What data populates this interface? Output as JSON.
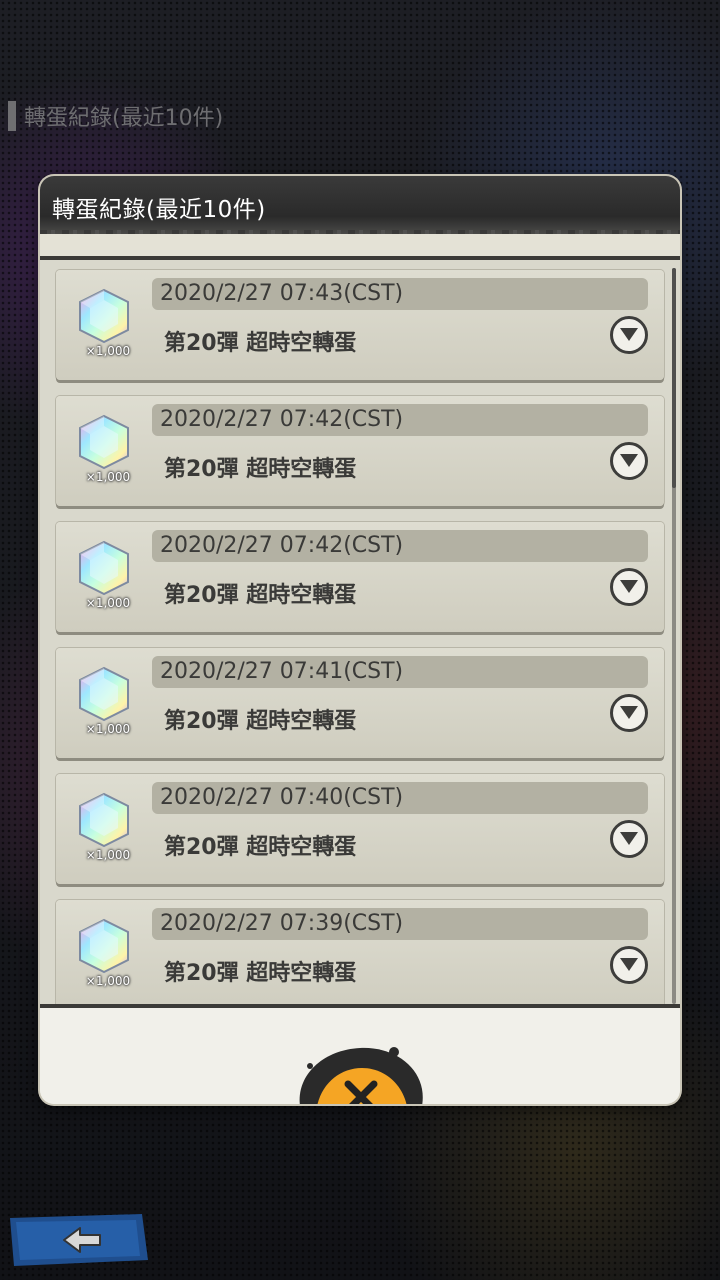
{
  "background": {
    "title": "轉蛋紀錄(最近10件)"
  },
  "modal": {
    "title": "轉蛋紀錄(最近10件)",
    "records": [
      {
        "timestamp": "2020/2/27 07:43(CST)",
        "name": "第20彈 超時空轉蛋",
        "qty": "×1,000",
        "icon": "rainbow-gem-icon"
      },
      {
        "timestamp": "2020/2/27 07:42(CST)",
        "name": "第20彈 超時空轉蛋",
        "qty": "×1,000",
        "icon": "rainbow-gem-icon"
      },
      {
        "timestamp": "2020/2/27 07:42(CST)",
        "name": "第20彈 超時空轉蛋",
        "qty": "×1,000",
        "icon": "rainbow-gem-icon"
      },
      {
        "timestamp": "2020/2/27 07:41(CST)",
        "name": "第20彈 超時空轉蛋",
        "qty": "×1,000",
        "icon": "rainbow-gem-icon"
      },
      {
        "timestamp": "2020/2/27 07:40(CST)",
        "name": "第20彈 超時空轉蛋",
        "qty": "×1,000",
        "icon": "rainbow-gem-icon"
      },
      {
        "timestamp": "2020/2/27 07:39(CST)",
        "name": "第20彈 超時空轉蛋",
        "qty": "×1,000",
        "icon": "rainbow-gem-icon"
      }
    ],
    "close_icon": "close-x-icon"
  },
  "nav": {
    "back_icon": "back-arrow-icon"
  },
  "colors": {
    "accent": "#f5a524",
    "card": "#d6d4c7",
    "header": "#2f2f2f"
  }
}
